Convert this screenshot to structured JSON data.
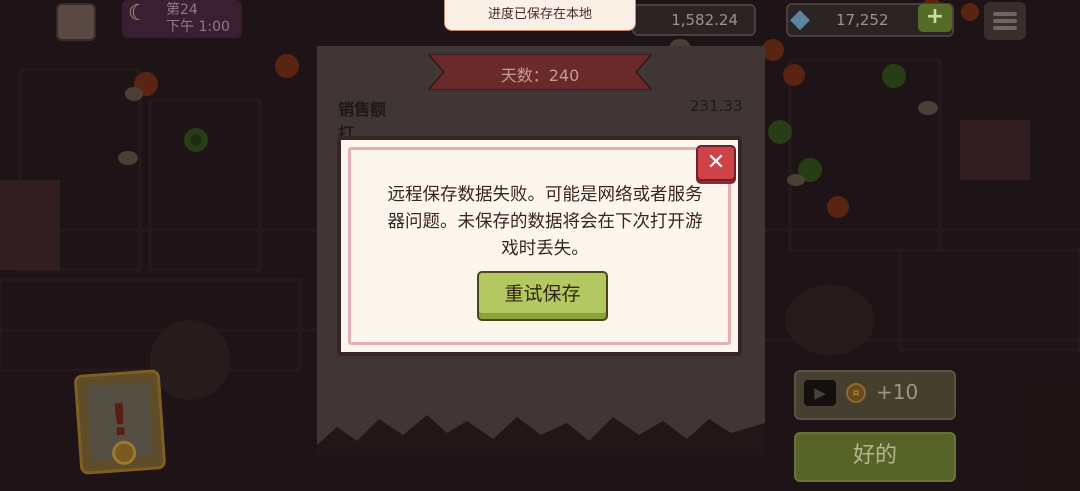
{
  "toast": {
    "text": "进度已保存在本地"
  },
  "hud": {
    "day_line1": "第24",
    "day_line2": "下午 1:00",
    "money": "1,582.24",
    "gems": "17,252",
    "plus_label": "+"
  },
  "summary": {
    "day_title": "天数：240",
    "sales_label": "销售额",
    "sales_value": "231.33",
    "row2_label": "打"
  },
  "modal": {
    "message": "远程保存数据失败。可能是网络或者服务器问题。未保存的数据将会在下次打开游戏时丢失。",
    "close_label": "✕",
    "retry_label": "重试保存"
  },
  "right_panel": {
    "ad_reward": "+10",
    "ok_label": "好的"
  },
  "warning_card": {
    "symbol": "!"
  },
  "colors": {
    "modal_bg": "#fdf6ec",
    "modal_border": "#382527",
    "modal_inner_border": "#e4aeb8",
    "close_red": "#cf4247",
    "retry_green": "#b3c861",
    "toast_bg": "#fbf0e5"
  },
  "icons": {
    "moon": "moon-icon",
    "gem": "diamond-icon",
    "menu": "hamburger-menu-icon",
    "play": "video-play-icon",
    "coin": "coin-icon",
    "close": "close-icon",
    "warning": "exclamation-icon"
  }
}
